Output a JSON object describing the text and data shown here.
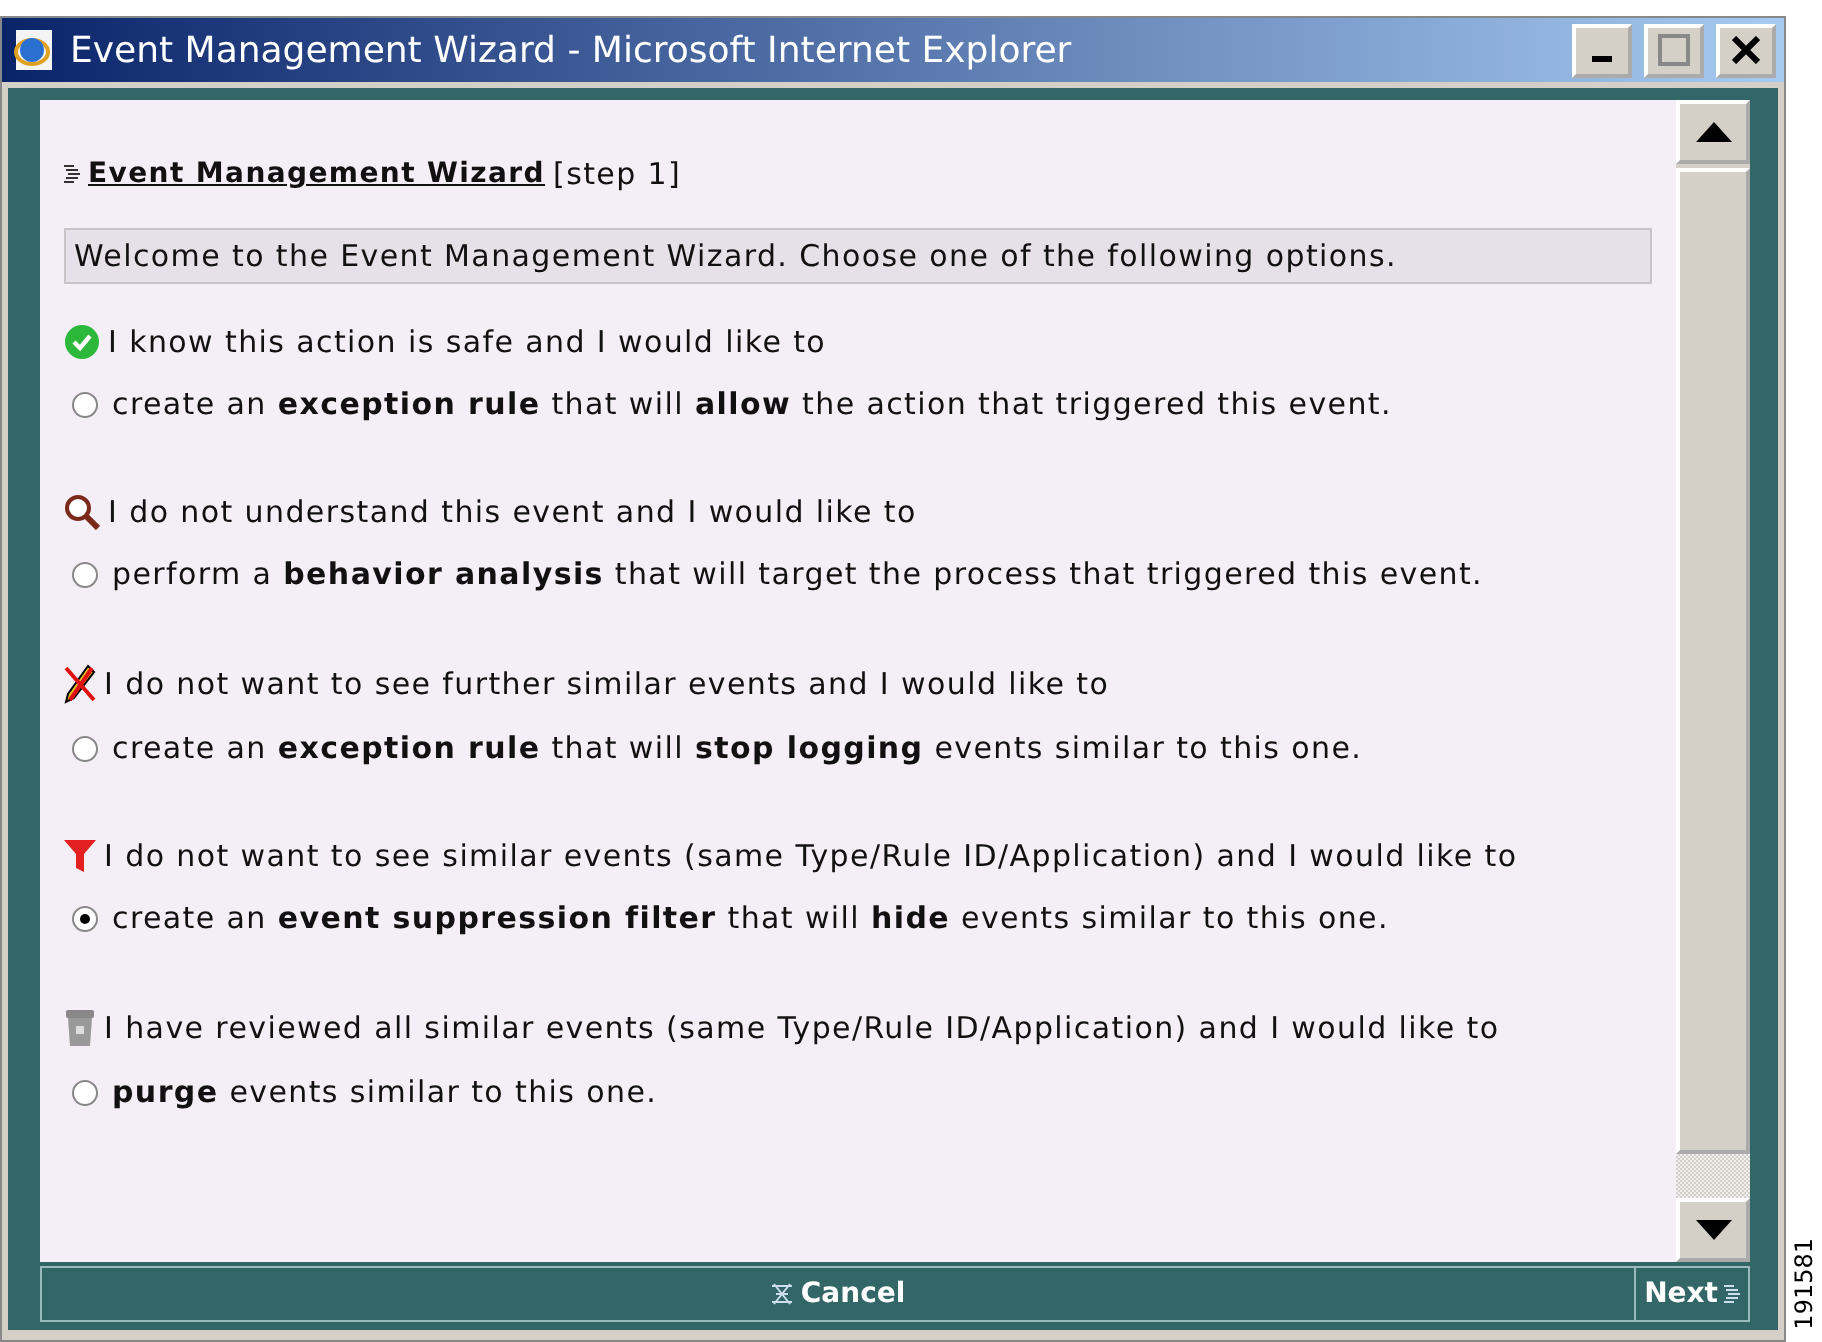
{
  "window": {
    "title": "Event Management Wizard - Microsoft Internet Explorer"
  },
  "wizard": {
    "title": "Event Management Wizard",
    "step": "[step 1]",
    "welcome": "Welcome to the Event Management Wizard. Choose one of the following options."
  },
  "options": [
    {
      "kind": "check",
      "intro": "I know this action is safe and I would like to",
      "text": "create an **exception rule** that will **allow** the action that triggered this event.",
      "selected": false
    },
    {
      "kind": "magnifier",
      "intro": "I do not understand this event and I would like to",
      "text": "perform a **behavior analysis** that will target the process that triggered this event.",
      "selected": false
    },
    {
      "kind": "pencil",
      "intro": "I do not want to see further similar events and I would like to",
      "text": "create an **exception rule** that will **stop logging** events similar to this one.",
      "selected": false
    },
    {
      "kind": "funnel",
      "intro": "I do not want to see similar events (same Type/Rule ID/Application) and I would like to",
      "text": "create an **event suppression filter** that will **hide** events similar to this one.",
      "selected": true
    },
    {
      "kind": "bin",
      "intro": "I have reviewed all similar events (same Type/Rule ID/Application) and I would like to",
      "text": "**purge** events similar to this one.",
      "selected": false
    }
  ],
  "footer": {
    "cancel": "Cancel",
    "next": "Next"
  },
  "figure_number": "191581"
}
